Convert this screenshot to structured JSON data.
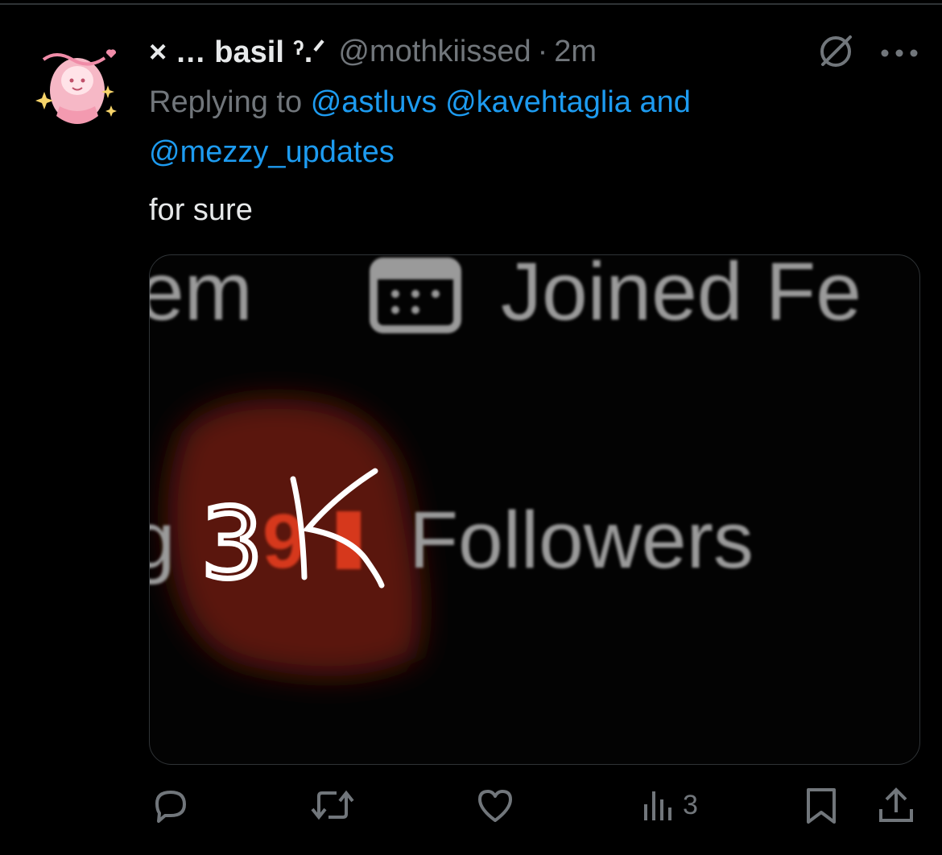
{
  "post": {
    "display_name": "× … basil ˀ.ᐟ",
    "handle": "@mothkiissed",
    "separator": "·",
    "time": "2m",
    "replying_prefix": "Replying to",
    "mentions": [
      "@astluvs",
      "@kavehtaglia",
      "@mezzy_updates"
    ],
    "mention_joiner": "and",
    "text": "for sure"
  },
  "media": {
    "line1_left": "em",
    "line1_right": "Joined Fe",
    "line2_left": "g",
    "handwritten_number": "3",
    "handwritten_suffix": "k",
    "underlying_digits": "9",
    "followers_label": "Followers"
  },
  "actions": {
    "icons": [
      "reply-icon",
      "retweet-icon",
      "like-icon",
      "views-icon",
      "bookmark-icon",
      "share-icon"
    ],
    "views_count": "3"
  },
  "colors": {
    "background": "#000000",
    "text": "#e7e9ea",
    "muted": "#71767b",
    "link": "#1d9bf0",
    "border": "#2f3336"
  }
}
